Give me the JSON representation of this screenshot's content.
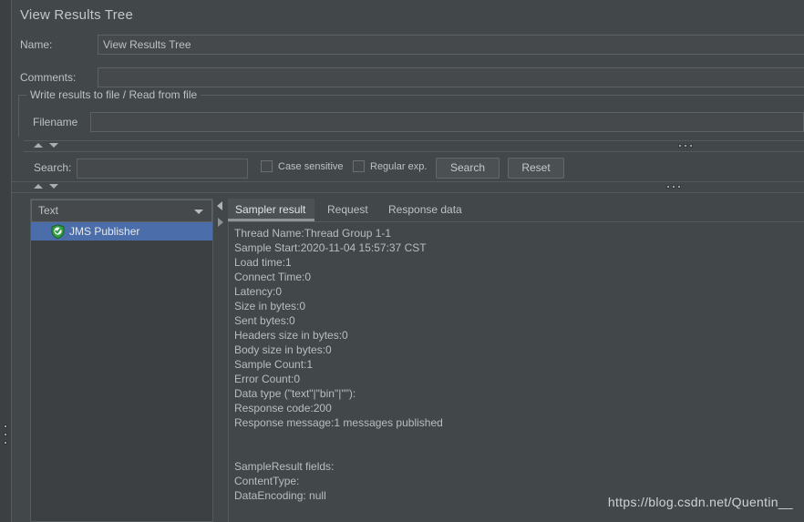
{
  "window": {
    "title": "View Results Tree"
  },
  "form": {
    "name_label": "Name:",
    "name_value": "View Results Tree",
    "comments_label": "Comments:",
    "comments_value": "",
    "group_title": "Write results to file / Read from file",
    "filename_label": "Filename",
    "filename_value": ""
  },
  "search": {
    "label": "Search:",
    "value": "",
    "case_sensitive_label": "Case sensitive",
    "regular_exp_label": "Regular exp.",
    "search_button": "Search",
    "reset_button": "Reset"
  },
  "tree": {
    "renderer_selected": "Text",
    "items": [
      {
        "label": "JMS Publisher",
        "icon": "shield-success-icon",
        "selected": true
      }
    ]
  },
  "tabs": [
    {
      "label": "Sampler result",
      "active": true
    },
    {
      "label": "Request",
      "active": false
    },
    {
      "label": "Response data",
      "active": false
    }
  ],
  "sampler_result": {
    "lines": [
      "Thread Name:Thread Group 1-1",
      "Sample Start:2020-11-04 15:57:37 CST",
      "Load time:1",
      "Connect Time:0",
      "Latency:0",
      "Size in bytes:0",
      "Sent bytes:0",
      "Headers size in bytes:0",
      "Body size in bytes:0",
      "Sample Count:1",
      "Error Count:0",
      "Data type (\"text\"|\"bin\"|\"\"):",
      "Response code:200",
      "Response message:1 messages published",
      "",
      "",
      "SampleResult fields:",
      "ContentType:",
      "DataEncoding: null"
    ]
  },
  "watermark": {
    "text": "https://blog.csdn.net/Quentin__"
  },
  "colors": {
    "background": "#42474a",
    "panel_dark": "#3c4042",
    "selection_blue": "#4b6eab",
    "text": "#bdc1c3",
    "border": "#55595c",
    "shield_green": "#2f9e41"
  }
}
